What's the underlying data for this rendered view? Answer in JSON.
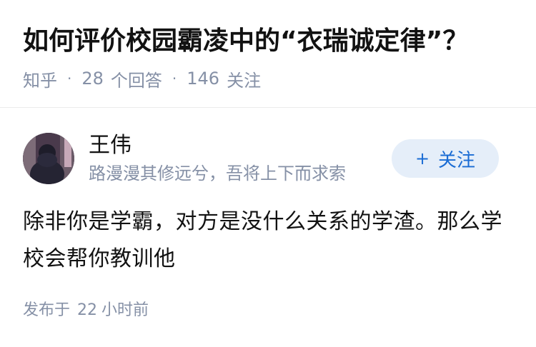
{
  "question": {
    "title": "如何评价校园霸凌中的“衣瑞诚定律”？",
    "source": "知乎",
    "separator": "·",
    "answer_count": "28",
    "answer_label": "个回答",
    "follower_count": "146",
    "follower_label": "关注"
  },
  "answer": {
    "author": {
      "name": "王伟",
      "bio": "路漫漫其修远兮，吾将上下而求索",
      "avatar_icon": "user-avatar-photo"
    },
    "follow_button": {
      "icon": "+",
      "label": "关注"
    },
    "content": "除非你是学霸，对方是没什么关系的学渣。那么学校会帮你教训他",
    "publish": {
      "prefix": "发布于",
      "value": "22",
      "unit": "小时前"
    }
  },
  "colors": {
    "primary_text": "#121212",
    "secondary_text": "#8590a6",
    "accent": "#1a6cd4",
    "follow_button_bg": "#e5eef9",
    "divider": "#ebebeb"
  }
}
